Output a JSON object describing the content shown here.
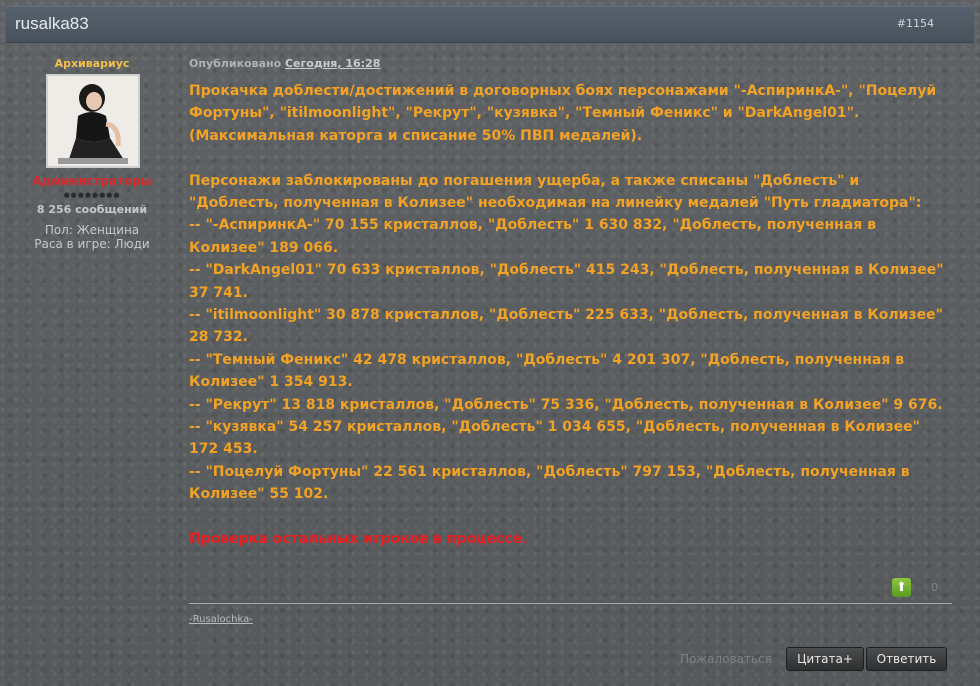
{
  "post": {
    "author": "rusalka83",
    "post_number": "#1154"
  },
  "user": {
    "rank_title": "Архивариус",
    "group": "Администраторы",
    "pips": "●●●●●●●●",
    "post_count": "8 256 сообщений",
    "gender": "Пол: Женщина",
    "race": "Раса в игре: Люди"
  },
  "meta": {
    "published_label": "Опубликовано",
    "published_date": "Сегодня, 16:28"
  },
  "body": {
    "intro": "Прокачка доблести/достижений в договорных боях персонажами \"-АспиринкА-\", \"Поцелуй Фортуны\", \"itilmoonlight\", \"Рекрут\", \"кузявка\", \"Темный Феникс\" и \"DarkAngel01\". (Максимальная каторга и списание 50% ПВП медалей).",
    "blocked": "Персонажи заблокированы до погашения ущерба, а также списаны \"Доблесть\" и \"Доблесть, полученная в Колизее\" необходимая на линейку медалей \"Путь гладиатора\":",
    "items": [
      "-- \"-АспиринкА-\" 70 155 кристаллов, \"Доблесть\" 1 630 832, \"Доблесть, полученная в Колизее\" 189 066.",
      "-- \"DarkAngel01\" 70 633 кристаллов, \"Доблесть\" 415 243, \"Доблесть, полученная в Колизее\" 37 741.",
      "-- \"itilmoonlight\" 30 878 кристаллов, \"Доблесть\" 225 633, \"Доблесть, полученная в Колизее\" 28 732.",
      "-- \"Темный Феникс\" 42 478 кристаллов, \"Доблесть\" 4 201 307, \"Доблесть, полученная в Колизее\" 1 354 913.",
      "-- \"Рекрут\" 13 818 кристаллов, \"Доблесть\" 75 336, \"Доблесть, полученная в Колизее\" 9 676.",
      "-- \"кузявка\" 54 257 кристаллов, \"Доблесть\" 1 034 655, \"Доблесть, полученная в Колизее\" 172 453.",
      "-- \"Поцелуй Фортуны\" 22 561 кристаллов, \"Доблесть\" 797 153, \"Доблесть, полученная в Колизее\" 55 102."
    ],
    "note": "Проверка остальных игроков в процессе."
  },
  "reputation": {
    "icon": "arrow-up-icon",
    "count": "0"
  },
  "signature": "-Rusalochka-",
  "actions": {
    "report": "Пожаловаться",
    "quote": "Цитата+",
    "reply": "Ответить"
  },
  "colors": {
    "body_text": "#f2a224",
    "note_text": "#e81e22",
    "group_text": "#d8282c",
    "rank_text": "#f2c14a"
  }
}
